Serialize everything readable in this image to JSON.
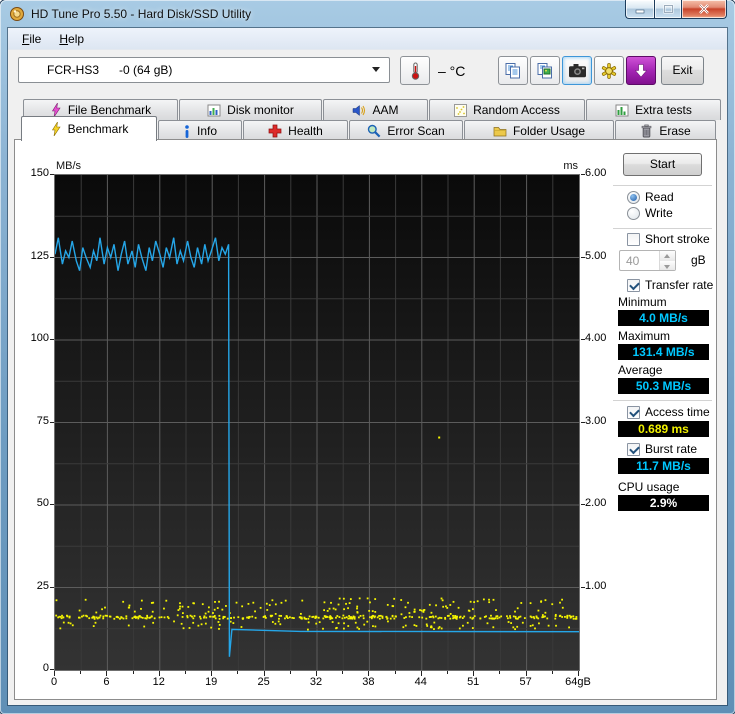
{
  "window": {
    "title": "HD Tune Pro 5.50 - Hard Disk/SSD Utility"
  },
  "menu": {
    "file": "File",
    "help": "Help"
  },
  "toolbar": {
    "drive_selector": "FCR-HS3      -0 (64 gB)",
    "temperature": "– °C",
    "exit": "Exit"
  },
  "tabs": {
    "row1": [
      {
        "label": "File Benchmark"
      },
      {
        "label": "Disk monitor"
      },
      {
        "label": "AAM"
      },
      {
        "label": "Random Access"
      },
      {
        "label": "Extra tests"
      }
    ],
    "row2": [
      {
        "label": "Benchmark"
      },
      {
        "label": "Info"
      },
      {
        "label": "Health"
      },
      {
        "label": "Error Scan"
      },
      {
        "label": "Folder Usage"
      },
      {
        "label": "Erase"
      }
    ],
    "active": "Benchmark"
  },
  "controls": {
    "start": "Start",
    "read": "Read",
    "write": "Write",
    "short_stroke": "Short stroke",
    "capacity_value": "40",
    "capacity_unit": "gB",
    "transfer_rate": "Transfer rate",
    "minimum_label": "Minimum",
    "minimum_value": "4.0 MB/s",
    "maximum_label": "Maximum",
    "maximum_value": "131.4 MB/s",
    "average_label": "Average",
    "average_value": "50.3 MB/s",
    "access_time": "Access time",
    "access_time_value": "0.689 ms",
    "burst_rate": "Burst rate",
    "burst_rate_value": "11.7 MB/s",
    "cpu_usage_label": "CPU usage",
    "cpu_usage_value": "2.9%"
  },
  "chart_data": {
    "type": "line",
    "title": "HD Tune Pro read benchmark: transfer rate line + access time scatter",
    "x_axis": {
      "label": "gB",
      "range": [
        0,
        64
      ],
      "tick_labels": [
        "0",
        "6",
        "12",
        "19",
        "25",
        "32",
        "38",
        "44",
        "51",
        "57",
        "64gB"
      ]
    },
    "y_left": {
      "label": "MB/s",
      "range": [
        0,
        150
      ],
      "tick_labels": [
        "150",
        "125",
        "100",
        "75",
        "50",
        "25",
        "0"
      ]
    },
    "y_right": {
      "label": "ms",
      "range": [
        0,
        6
      ],
      "tick_labels": [
        "6.00",
        "5.00",
        "4.00",
        "3.00",
        "2.00",
        "1.00"
      ]
    },
    "grid": true,
    "legend": "none",
    "colors": {
      "transfer_rate": "#25a6e8",
      "access_time": "#f6f600",
      "plot_bg_top": "#0a0a0a",
      "plot_bg_bottom": "#333333",
      "grid_major": "#5c5c5c",
      "grid_minor": "#3a3a3a"
    },
    "series": [
      {
        "name": "transfer_rate",
        "unit": "MB/s",
        "points": [
          [
            0.0,
            126
          ],
          [
            0.4,
            131
          ],
          [
            0.9,
            123
          ],
          [
            1.3,
            127
          ],
          [
            1.7,
            125
          ],
          [
            2.1,
            130
          ],
          [
            2.6,
            124
          ],
          [
            3.0,
            121
          ],
          [
            3.4,
            128
          ],
          [
            3.8,
            125
          ],
          [
            4.3,
            122
          ],
          [
            4.7,
            127
          ],
          [
            5.1,
            124
          ],
          [
            5.5,
            131
          ],
          [
            6.0,
            123
          ],
          [
            6.4,
            128
          ],
          [
            6.8,
            125
          ],
          [
            7.2,
            129
          ],
          [
            7.7,
            121
          ],
          [
            8.1,
            126
          ],
          [
            8.5,
            130
          ],
          [
            8.9,
            123
          ],
          [
            9.4,
            127
          ],
          [
            9.8,
            122
          ],
          [
            10.2,
            129
          ],
          [
            10.6,
            125
          ],
          [
            11.1,
            121
          ],
          [
            11.5,
            128
          ],
          [
            11.9,
            124
          ],
          [
            12.3,
            130
          ],
          [
            12.8,
            126
          ],
          [
            13.2,
            122
          ],
          [
            13.6,
            128
          ],
          [
            14.0,
            125
          ],
          [
            14.5,
            131
          ],
          [
            14.9,
            123
          ],
          [
            15.3,
            127
          ],
          [
            15.7,
            124
          ],
          [
            16.2,
            130
          ],
          [
            16.6,
            125
          ],
          [
            17.0,
            122
          ],
          [
            17.4,
            128
          ],
          [
            17.9,
            123
          ],
          [
            18.3,
            129
          ],
          [
            18.7,
            124
          ],
          [
            19.1,
            127
          ],
          [
            19.6,
            131
          ],
          [
            20.0,
            124
          ],
          [
            20.4,
            128
          ],
          [
            20.8,
            126
          ],
          [
            21.2,
            129
          ],
          [
            21.3,
            4.0
          ],
          [
            21.6,
            12.3
          ],
          [
            30.0,
            11.7
          ],
          [
            64.0,
            11.6
          ]
        ]
      },
      {
        "name": "access_time",
        "unit": "ms",
        "scatter": {
          "seed": 7,
          "count": 520,
          "x_range": [
            0,
            64
          ],
          "bands": [
            {
              "ms": [
                0.63,
                0.67
              ],
              "share": 0.58
            },
            {
              "ms": [
                0.67,
                0.88
              ],
              "share": 0.25
            },
            {
              "ms": [
                0.5,
                0.6
              ],
              "share": 0.17
            }
          ]
        },
        "outliers": [
          [
            46.8,
            2.83
          ]
        ]
      }
    ],
    "stats": {
      "minimum_mbps": 4.0,
      "maximum_mbps": 131.4,
      "average_mbps": 50.3,
      "access_time_ms": 0.689,
      "burst_rate_mbps": 11.7,
      "cpu_usage_pct": 2.9
    }
  }
}
